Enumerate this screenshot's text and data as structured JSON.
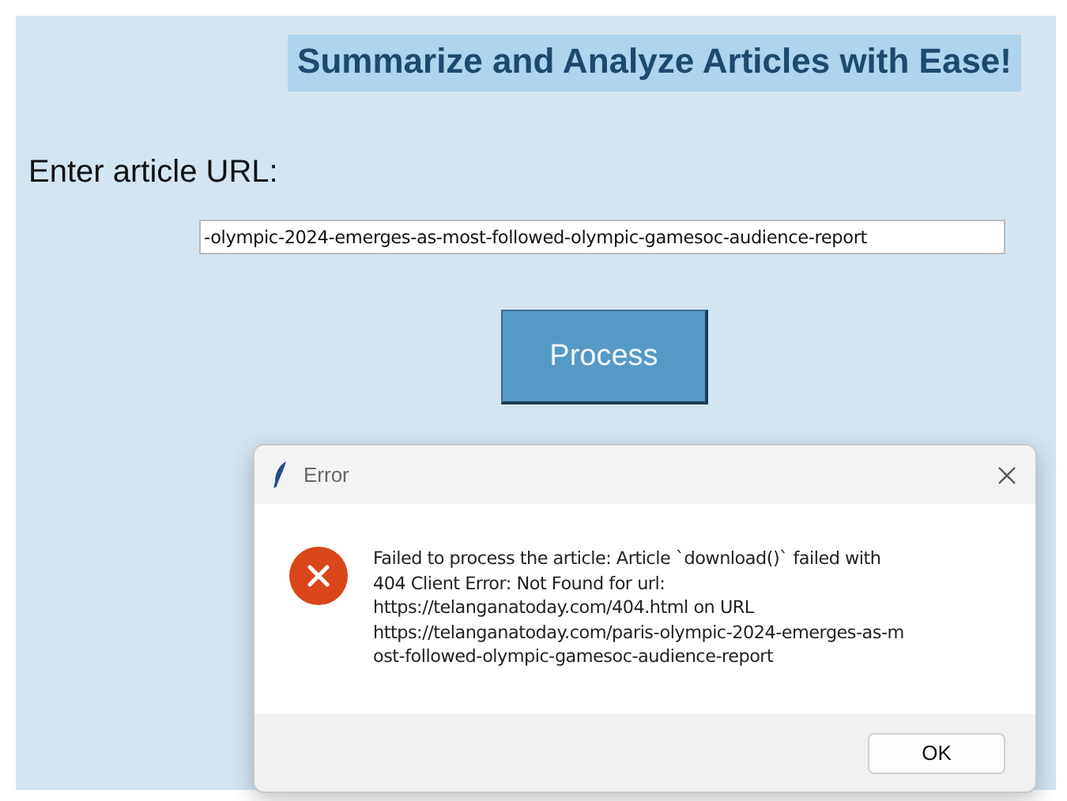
{
  "app": {
    "heading": "Summarize and Analyze Articles with Ease!",
    "url_label": "Enter article URL:",
    "url_field": {
      "value": "-olympic-2024-emerges-as-most-followed-olympic-gamesoc-audience-report"
    },
    "process_button": "Process"
  },
  "dialog": {
    "title": "Error",
    "message_lines": [
      "Failed to process the article: Article `download()` failed with",
      "404 Client Error: Not Found for url:",
      "https://telanganatoday.com/404.html on URL",
      "https://telanganatoday.com/paris-olympic-2024-emerges-as-m",
      "ost-followed-olympic-gamesoc-audience-report"
    ],
    "ok_button": "OK"
  }
}
